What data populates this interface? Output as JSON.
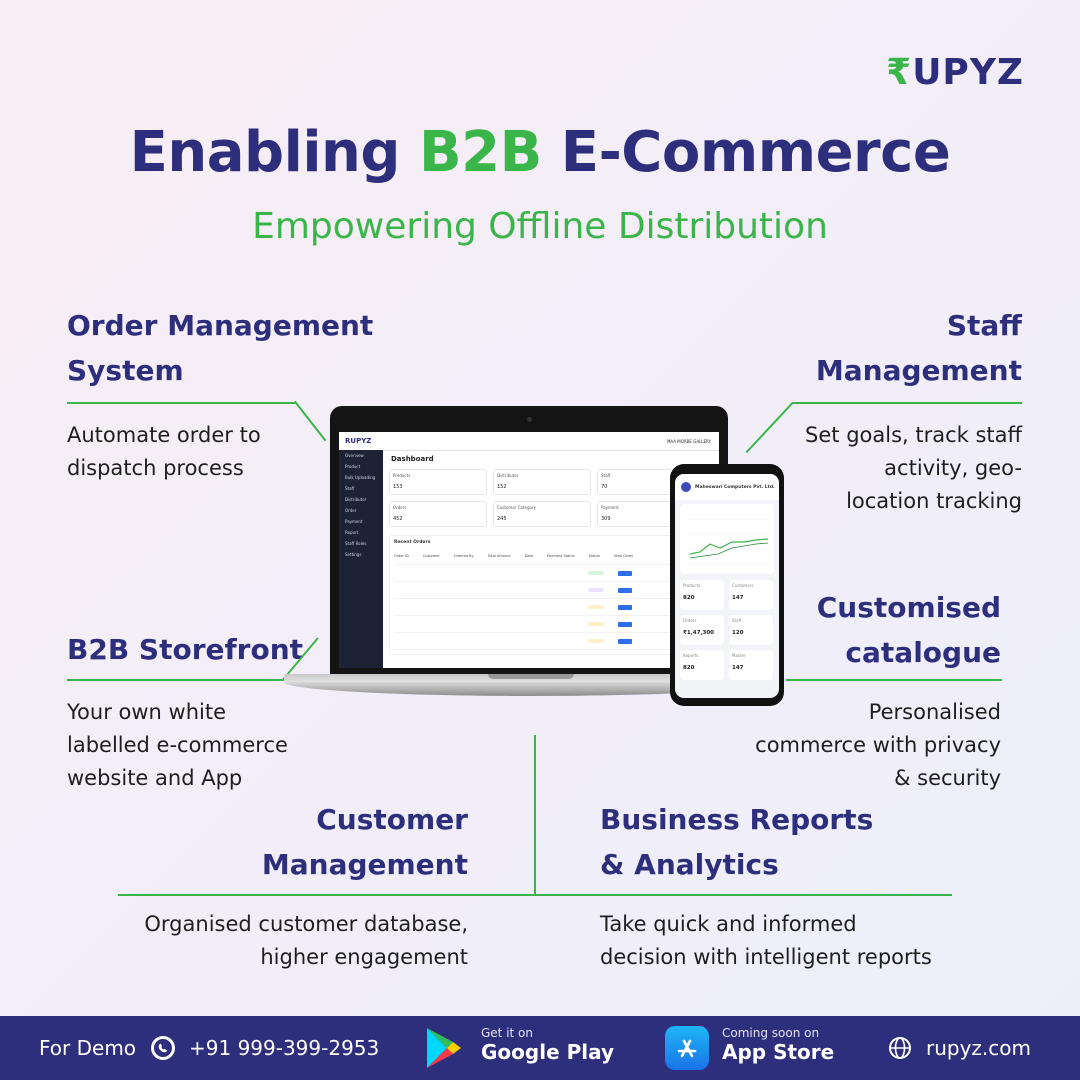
{
  "brand": {
    "logo_text": "RUPYZ",
    "accent": "#3ab54a",
    "primary": "#2e2f7c"
  },
  "headline": {
    "part1": "Enabling ",
    "highlight": "B2B",
    "part2": " E-Commerce"
  },
  "subheadline": "Empowering Offline Distribution",
  "features": {
    "order": {
      "title1": "Order Management",
      "title2": "System",
      "desc1": "Automate order to",
      "desc2": "dispatch process"
    },
    "staff": {
      "title1": "Staff",
      "title2": "Management",
      "desc1": "Set goals, track staff",
      "desc2": "activity, geo-",
      "desc3": "location tracking"
    },
    "storefront": {
      "title": "B2B Storefront",
      "desc1": "Your own white",
      "desc2": "labelled e-commerce",
      "desc3": "website and App"
    },
    "catalogue": {
      "title1": "Customised",
      "title2": "catalogue",
      "desc1": "Personalised",
      "desc2": "commerce with privacy",
      "desc3": "& security"
    },
    "customer": {
      "title1": "Customer",
      "title2": "Management",
      "desc1": "Organised customer database,",
      "desc2": "higher engagement"
    },
    "reports": {
      "title1": "Business Reports",
      "title2": "& Analytics",
      "desc1": "Take quick and informed",
      "desc2": "decision with intelligent reports"
    }
  },
  "laptop_screen": {
    "app": "RUPYZ",
    "user": "MAA MORBE GALLERY",
    "title": "Dashboard",
    "menu": [
      "Overview",
      "Product",
      "Bulk Uploading",
      "Staff",
      "Distributor",
      "Order",
      "Payment",
      "Report",
      "Staff Roles",
      "Settings"
    ],
    "cards": [
      {
        "label": "Products",
        "value": "153"
      },
      {
        "label": "Distributor",
        "value": "152"
      },
      {
        "label": "Staff",
        "value": "70"
      },
      {
        "label": "Orders",
        "value": "452"
      },
      {
        "label": "Customer Category",
        "value": "245"
      },
      {
        "label": "Payment",
        "value": "309"
      }
    ],
    "recent": "Recent Orders",
    "columns": [
      "Order ID",
      "Customer",
      "Ordered By",
      "Total Amount",
      "Date",
      "Payment Status",
      "Status",
      "View Order"
    ]
  },
  "phone_screen": {
    "company": "Maheswari Computers Pvt. Ltd.",
    "cards": [
      {
        "label": "Products",
        "value": "820"
      },
      {
        "label": "Customers",
        "value": "147"
      },
      {
        "label": "Orders",
        "value": "₹1,47,300"
      },
      {
        "label": "Staff",
        "value": "120"
      },
      {
        "label": "Reports",
        "value": "820"
      },
      {
        "label": "Master",
        "value": "147"
      }
    ]
  },
  "footer": {
    "demo_label": "For Demo",
    "phone": "+91 999-399-2953",
    "gp_small": "Get it on",
    "gp_big": "Google Play",
    "as_small": "Coming soon on",
    "as_big": "App Store",
    "website": "rupyz.com"
  }
}
